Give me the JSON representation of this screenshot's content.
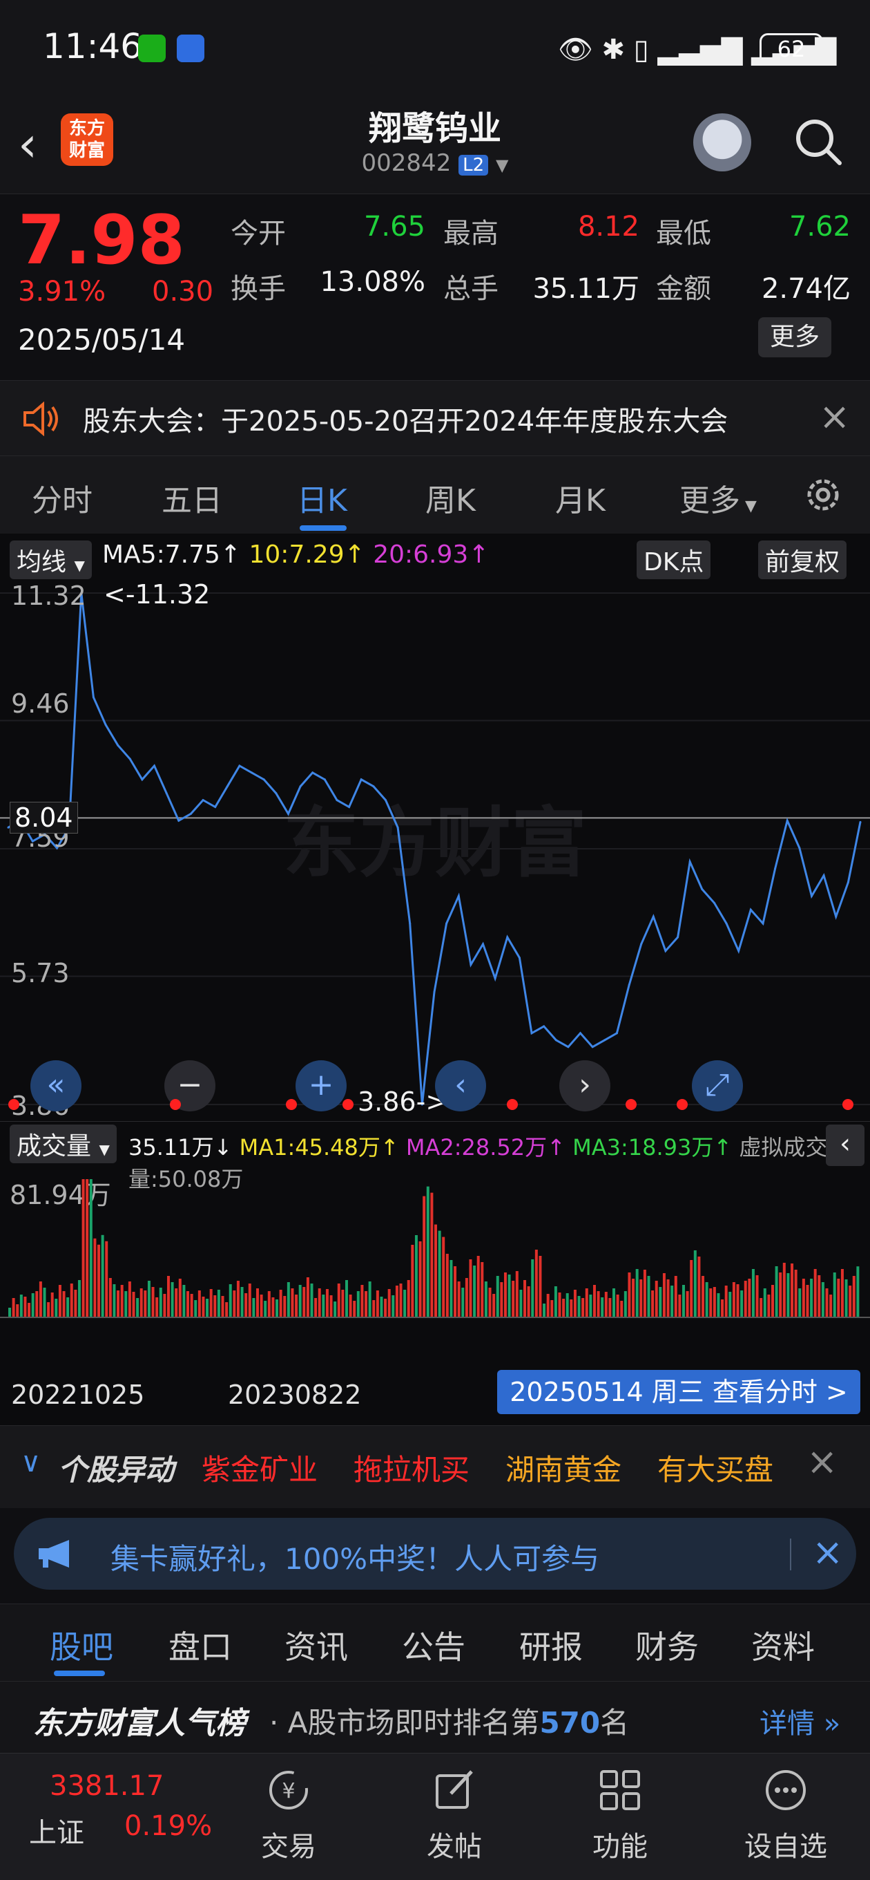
{
  "status_bar": {
    "time": "11:46",
    "battery": "62"
  },
  "header": {
    "title": "翔鹭钨业",
    "code": "002842",
    "level_badge": "L2",
    "logo_text": "东方财富"
  },
  "quote": {
    "price": "7.98",
    "change_pct": "3.91%",
    "change": "0.30",
    "date": "2025/05/14",
    "fields": [
      {
        "label": "今开",
        "value": "7.65",
        "color": "green"
      },
      {
        "label": "最高",
        "value": "8.12",
        "color": "red"
      },
      {
        "label": "最低",
        "value": "7.62",
        "color": "green"
      },
      {
        "label": "换手",
        "value": "13.08%",
        "color": "white"
      },
      {
        "label": "总手",
        "value": "35.11万",
        "color": "white"
      },
      {
        "label": "金额",
        "value": "2.74亿",
        "color": "white"
      }
    ],
    "more_label": "更多"
  },
  "notice": {
    "text": "股东大会：于2025-05-20召开2024年年度股东大会"
  },
  "period_tabs": [
    "分时",
    "五日",
    "日K",
    "周K",
    "月K",
    "更多"
  ],
  "active_period": "日K",
  "chart_toolbar": {
    "ma_select": "均线",
    "ma5": "MA5:7.75↑",
    "ma10": "10:7.29↑",
    "ma20": "20:6.93↑",
    "dk_label": "DK点",
    "adjust_label": "前复权"
  },
  "price_axis": [
    "11.32",
    "9.46",
    "7.59",
    "5.73",
    "3.86"
  ],
  "annotations": {
    "max": "<-11.32",
    "min": "3.86->",
    "current_line": "8.04"
  },
  "volume": {
    "select": "成交量",
    "value": "35.11万↓",
    "ma1": "MA1:45.48万↑",
    "ma2": "MA2:28.52万↑",
    "ma3": "MA3:18.93万↑",
    "virtual": "虚拟成交量:50.08万",
    "max_label": "81.94万"
  },
  "x_axis": {
    "start": "20221025",
    "mid": "20230822",
    "view_button": "20250514 周三 查看分时 >"
  },
  "chart_data": {
    "type": "line",
    "x_start": "2022-10-25",
    "x_end": "2025-05-14",
    "ylim": [
      3.86,
      11.32
    ],
    "y_ticks": [
      11.32,
      9.46,
      7.59,
      5.73,
      3.86
    ],
    "series": [
      {
        "values": [
          7.9,
          8.0,
          7.7,
          7.8,
          7.6,
          7.9,
          11.32,
          9.8,
          9.4,
          9.1,
          8.9,
          8.6,
          8.8,
          8.4,
          8.0,
          8.1,
          8.3,
          8.2,
          8.5,
          8.8,
          8.7,
          8.6,
          8.4,
          8.1,
          8.5,
          8.7,
          8.6,
          8.3,
          8.2,
          8.6,
          8.5,
          8.3,
          7.9,
          6.5,
          3.86,
          5.5,
          6.5,
          6.9,
          5.9,
          6.2,
          5.7,
          6.3,
          6.0,
          4.9,
          5.0,
          4.8,
          4.7,
          4.9,
          4.7,
          4.8,
          4.9,
          5.6,
          6.2,
          6.6,
          6.1,
          6.3,
          7.4,
          7.0,
          6.8,
          6.5,
          6.1,
          6.7,
          6.5,
          7.3,
          8.0,
          7.6,
          6.9,
          7.2,
          6.6,
          7.1,
          7.98
        ]
      }
    ]
  },
  "movers": {
    "label": "个股异动",
    "items": [
      "紫金矿业",
      "拖拉机买",
      "湖南黄金",
      "有大买盘"
    ]
  },
  "banner": {
    "text": "集卡赢好礼，100%中奖！人人可参与"
  },
  "content_tabs": [
    "股吧",
    "盘口",
    "资讯",
    "公告",
    "研报",
    "财务",
    "资料"
  ],
  "popularity": {
    "brand": "东方财富人气榜",
    "desc_prefix": "· A股市场即时排名第",
    "rank": "570",
    "desc_suffix": "名",
    "detail": "详情"
  },
  "bottom_nav": {
    "index_value": "3381.17",
    "index_name": "上证",
    "index_pct": "0.19%",
    "items": [
      "交易",
      "发帖",
      "功能",
      "设自选"
    ]
  }
}
